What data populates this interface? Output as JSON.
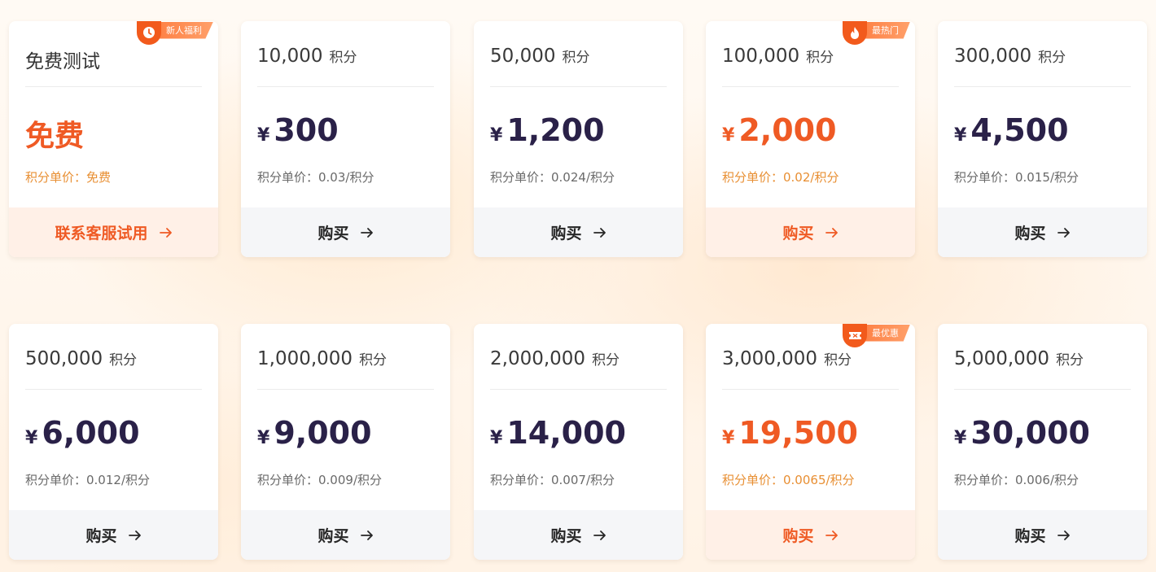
{
  "unit_label": "积分",
  "currency_symbol": "¥",
  "cards": [
    {
      "title": "免费测试",
      "price": "免费",
      "unit_price": "积分单价：免费",
      "button": "联系客服试用",
      "badge": "新人福利",
      "badge_icon": "clock-icon",
      "accent": true
    },
    {
      "amount": "10,000",
      "price": "300",
      "unit_price": "积分单价：0.03/积分",
      "button": "购买"
    },
    {
      "amount": "50,000",
      "price": "1,200",
      "unit_price": "积分单价：0.024/积分",
      "button": "购买"
    },
    {
      "amount": "100,000",
      "price": "2,000",
      "unit_price": "积分单价：0.02/积分",
      "button": "购买",
      "badge": "最热门",
      "badge_icon": "fire-icon",
      "accent": true
    },
    {
      "amount": "300,000",
      "price": "4,500",
      "unit_price": "积分单价：0.015/积分",
      "button": "购买"
    },
    {
      "amount": "500,000",
      "price": "6,000",
      "unit_price": "积分单价：0.012/积分",
      "button": "购买"
    },
    {
      "amount": "1,000,000",
      "price": "9,000",
      "unit_price": "积分单价：0.009/积分",
      "button": "购买"
    },
    {
      "amount": "2,000,000",
      "price": "14,000",
      "unit_price": "积分单价：0.007/积分",
      "button": "购买"
    },
    {
      "amount": "3,000,000",
      "price": "19,500",
      "unit_price": "积分单价：0.0065/积分",
      "button": "购买",
      "badge": "最优惠",
      "badge_icon": "ticket-icon",
      "accent": true
    },
    {
      "amount": "5,000,000",
      "price": "30,000",
      "unit_price": "积分单价：0.006/积分",
      "button": "购买"
    }
  ],
  "colors": {
    "accent": "#ef5a24",
    "accent_light": "#fff0e7",
    "unit_price_accent": "#e88f33",
    "price_dark": "#2a2148",
    "button_bg": "#f5f6f8"
  }
}
